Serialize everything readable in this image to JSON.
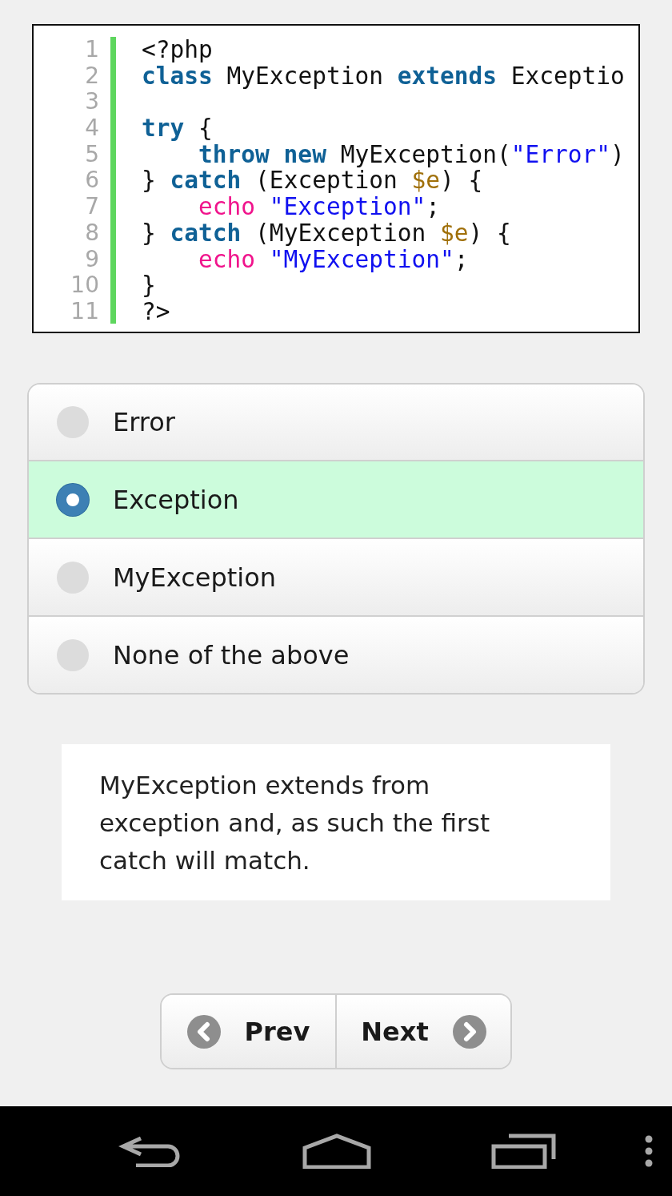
{
  "code": {
    "lines": [
      {
        "number": "1",
        "tokens": [
          {
            "text": "<?php",
            "kind": "plain"
          }
        ]
      },
      {
        "number": "2",
        "tokens": [
          {
            "text": "class",
            "kind": "keyword"
          },
          {
            "text": " MyException ",
            "kind": "plain"
          },
          {
            "text": "extends",
            "kind": "keyword"
          },
          {
            "text": " Exceptio",
            "kind": "plain"
          }
        ]
      },
      {
        "number": "3"
      },
      {
        "number": "4",
        "tokens": [
          {
            "text": "try",
            "kind": "keyword"
          },
          {
            "text": " {",
            "kind": "plain"
          }
        ]
      },
      {
        "number": "5",
        "indented": true,
        "tokens": [
          {
            "text": "throw",
            "kind": "keyword"
          },
          {
            "text": " new",
            "kind": "keyword"
          },
          {
            "text": " MyException(",
            "kind": "plain"
          },
          {
            "text": "\"Error\"",
            "kind": "string"
          },
          {
            "text": ")",
            "kind": "plain"
          }
        ]
      },
      {
        "number": "6",
        "tokens": [
          {
            "text": "} ",
            "kind": "plain"
          },
          {
            "text": "catch",
            "kind": "keyword"
          },
          {
            "text": " (Exception ",
            "kind": "plain"
          },
          {
            "text": "$e",
            "kind": "variable"
          },
          {
            "text": ") {",
            "kind": "plain"
          }
        ]
      },
      {
        "number": "7",
        "indented": true,
        "tokens": [
          {
            "text": "echo",
            "kind": "builtin"
          },
          {
            "text": " \"Exception\"",
            "kind": "string"
          },
          {
            "text": ";",
            "kind": "plain"
          }
        ]
      },
      {
        "number": "8",
        "tokens": [
          {
            "text": "} ",
            "kind": "plain"
          },
          {
            "text": "catch",
            "kind": "keyword"
          },
          {
            "text": " (MyException ",
            "kind": "plain"
          },
          {
            "text": "$e",
            "kind": "variable"
          },
          {
            "text": ") {",
            "kind": "plain"
          }
        ]
      },
      {
        "number": "9",
        "indented": true,
        "tokens": [
          {
            "text": "echo",
            "kind": "builtin"
          },
          {
            "text": " \"MyException\"",
            "kind": "string"
          },
          {
            "text": ";",
            "kind": "plain"
          }
        ]
      },
      {
        "number": "10",
        "tokens": [
          {
            "text": "}",
            "kind": "plain"
          }
        ]
      },
      {
        "number": "11",
        "tokens": [
          {
            "text": "?>",
            "kind": "plain"
          }
        ]
      }
    ]
  },
  "options": [
    {
      "label": "Error",
      "selected": false
    },
    {
      "label": "Exception",
      "selected": true
    },
    {
      "label": "MyException",
      "selected": false
    },
    {
      "label": "None of the above",
      "selected": false
    }
  ],
  "explanation": "MyException extends from exception and, as such the first catch will match.",
  "navigation": [
    {
      "label": "Prev",
      "kind": "prev"
    },
    {
      "label": "Next",
      "kind": "next"
    }
  ]
}
